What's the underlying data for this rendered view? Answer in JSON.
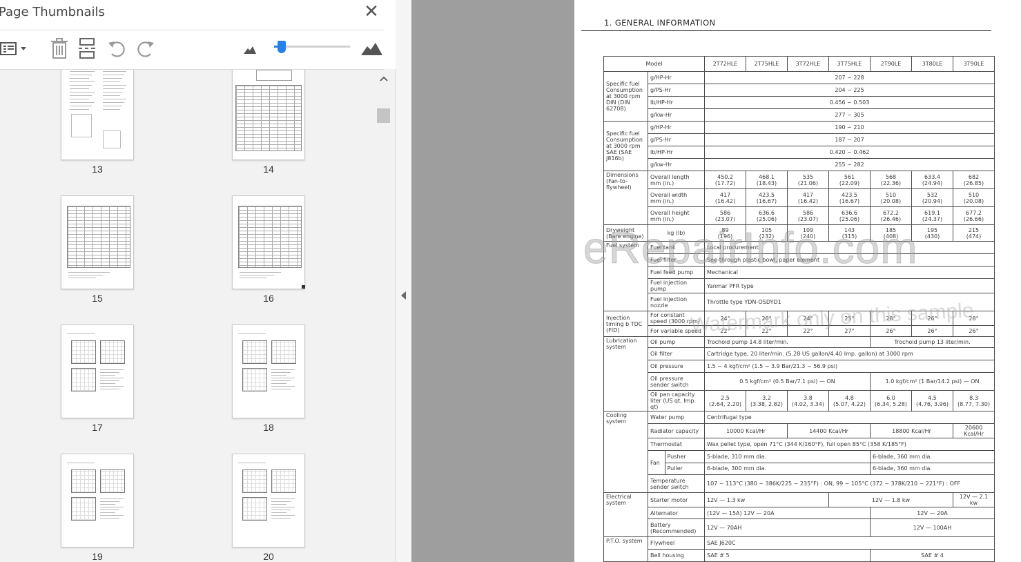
{
  "panel": {
    "title": "Page Thumbnails",
    "close_icon": "close-icon",
    "toolbar": {
      "options_icon": "thumbnail-options-icon",
      "delete_icon": "delete-pages-icon",
      "insert_icon": "insert-pages-icon",
      "rotate_left_icon": "rotate-counterclockwise-icon",
      "rotate_right_icon": "rotate-clockwise-icon",
      "zoom_out_icon": "small-thumbnail-icon",
      "zoom_in_icon": "large-thumbnail-icon",
      "thumbnail_size_fraction": 0.05
    }
  },
  "thumbnails": [
    {
      "page": "13",
      "kind": "text-figure"
    },
    {
      "page": "14",
      "kind": "table-figure"
    },
    {
      "page": "15",
      "kind": "table"
    },
    {
      "page": "16",
      "kind": "table"
    },
    {
      "page": "17",
      "kind": "curves"
    },
    {
      "page": "18",
      "kind": "curves"
    },
    {
      "page": "19",
      "kind": "curves"
    },
    {
      "page": "20",
      "kind": "curves"
    }
  ],
  "document": {
    "heading": "1. GENERAL INFORMATION",
    "watermark_main": "eRepairInfo.com",
    "watermark_sub": "Watermark only on this sample",
    "header": {
      "model_label": "Model",
      "models": [
        "2T72HLE",
        "2T75HLE",
        "3T72HLE",
        "3T75HLE",
        "2T90LE",
        "3T80LE",
        "3T90LE"
      ]
    },
    "fuel_din": {
      "group": "Specific fuel Consumption at 3000 rpm DIN (DIN 62708)",
      "rows": [
        {
          "unit": "g/HP-Hr",
          "value": "207 ~ 228"
        },
        {
          "unit": "g/PS-Hr",
          "value": "204 ~ 225"
        },
        {
          "unit": "lb/HP-Hr",
          "value": "0.456 ~ 0.503"
        },
        {
          "unit": "g/kw-Hr",
          "value": "277 ~ 305"
        }
      ]
    },
    "fuel_sae": {
      "group": "Specific fuel Consumption at 3000 rpm SAE (SAE J816b)",
      "rows": [
        {
          "unit": "g/HP-Hr",
          "value": "190 ~ 210"
        },
        {
          "unit": "g/PS-Hr",
          "value": "187 ~ 207"
        },
        {
          "unit": "lb/HP-Hr",
          "value": "0.420 ~ 0.462"
        },
        {
          "unit": "g/kw-Hr",
          "value": "255 ~ 282"
        }
      ]
    },
    "dimensions": {
      "group": "Dimensions (Fan-to-flywheel)",
      "rows": [
        {
          "label": "Overall length",
          "unit": "mm (in.)",
          "values": [
            [
              "450.2",
              "(17.72)"
            ],
            [
              "468.1",
              "(18.43)"
            ],
            [
              "535",
              "(21.06)"
            ],
            [
              "561",
              "(22.09)"
            ],
            [
              "568",
              "(22.36)"
            ],
            [
              "633.4",
              "(24.94)"
            ],
            [
              "682",
              "(26.85)"
            ]
          ]
        },
        {
          "label": "Overall width",
          "unit": "mm (in.)",
          "values": [
            [
              "417",
              "(16.42)"
            ],
            [
              "423.5",
              "(16.67)"
            ],
            [
              "417",
              "(16.42)"
            ],
            [
              "423.5",
              "(16.67)"
            ],
            [
              "510",
              "(20.08)"
            ],
            [
              "532",
              "(20.94)"
            ],
            [
              "510",
              "(20.08)"
            ]
          ]
        },
        {
          "label": "Overall height",
          "unit": "mm (in.)",
          "values": [
            [
              "586",
              "(23.07)"
            ],
            [
              "636.6",
              "(25.06)"
            ],
            [
              "586",
              "(23.07)"
            ],
            [
              "636.6",
              "(25.06)"
            ],
            [
              "672.2",
              "(26.46)"
            ],
            [
              "619.1",
              "(24.37)"
            ],
            [
              "677.2",
              "(26.66)"
            ]
          ]
        }
      ]
    },
    "dryweight": {
      "group": "Dryweight (Bare engine)",
      "unit": "kg (lb)",
      "values": [
        [
          "89",
          "(196)"
        ],
        [
          "105",
          "(232)"
        ],
        [
          "109",
          "(240)"
        ],
        [
          "143",
          "(315)"
        ],
        [
          "185",
          "(408)"
        ],
        [
          "195",
          "(430)"
        ],
        [
          "215",
          "(474)"
        ]
      ]
    },
    "fuel_system": {
      "group": "Fuel system",
      "rows": [
        {
          "label": "Fuel tank",
          "value": "Local procurement"
        },
        {
          "label": "Fuel filter",
          "value": "See-through plastic bowl, paper element"
        },
        {
          "label": "Fuel feed pump",
          "value": "Mechanical"
        },
        {
          "label": "Fuel injection pump",
          "value": "Yanmar PFR type"
        },
        {
          "label": "Fuel injection nozzle",
          "value": "Throttle type YDN-OSDYD1"
        }
      ]
    },
    "injection": {
      "group": "Injection timing b TDC (FID)",
      "rows": [
        {
          "label": "For constant speed (3000 rpm)",
          "values": [
            "24°",
            "26°",
            "24°",
            "25°",
            "28°",
            "26°",
            "28°"
          ]
        },
        {
          "label": "For variable speed",
          "values": [
            "22°",
            "22°",
            "22°",
            "27°",
            "26°",
            "26°",
            "26°"
          ]
        }
      ]
    },
    "lubrication": {
      "group": "Lubrication system",
      "oil_pump_label": "Oil pump",
      "oil_pump_a": "Trochoid pump",
      "oil_pump_a_flow": "14.8 liter/min.",
      "oil_pump_b": "Trochoid pump",
      "oil_pump_b_flow": "13 liter/min.",
      "oil_filter_label": "Oil filter",
      "oil_filter": "Cartridge type, 20 liter/min. (5.28 US gallon/4.40 Imp. gallon) at 3000 rpm",
      "oil_pressure_label": "Oil pressure",
      "oil_pressure": "1.5 ~ 4 kgf/cm²  (1.5 ~ 3.9 Bar/21.3 ~ 56.9 psi)",
      "sender_label": "Oil pressure sender switch",
      "sender_a": "0.5 kgf/cm² (0.5 Bar/7.1 psi) — ON",
      "sender_b": "1.0 kgf/cm² (1 Bar/14.2 psi) — ON",
      "pan_label": "Oil pan capacity liter (US qt, Imp. qt)",
      "pan_values": [
        [
          "2.5",
          "(2.64, 2.20)"
        ],
        [
          "3.2",
          "(3.38, 2.82)"
        ],
        [
          "3.8",
          "(4.02, 3.34)"
        ],
        [
          "4.8",
          "(5.07, 4.22)"
        ],
        [
          "6.0",
          "(6.34, 5.28)"
        ],
        [
          "4.5",
          "(4.76, 3.96)"
        ],
        [
          "8.3",
          "(8.77, 7.30)"
        ]
      ]
    },
    "cooling": {
      "group": "Cooling system",
      "water_pump_label": "Water pump",
      "water_pump": "Centrifugal type",
      "radiator_label": "Radiator capacity",
      "radiator": [
        "10000 Kcal/Hr",
        "14400 Kcal/Hr",
        "18800 Kcal/Hr",
        "20600 Kcal/Hr"
      ],
      "thermostat_label": "Thermostat",
      "thermostat": "Wax pellet type, open 71°C (344 K/160°F), full open 85°C (358 K/185°F)",
      "fan_label": "Fan",
      "pusher_label": "Pusher",
      "pusher_a": "5-blade, 310 mm dia.",
      "pusher_b": "6-blade, 360 mm dia.",
      "puller_label": "Puller",
      "puller_a": "6-blade, 300 mm dia.",
      "puller_b": "6-blade, 360 mm dia.",
      "temp_label": "Temperature sender switch",
      "temp_on": "107 ~ 113°C (380 ~ 386K/225 ~ 235°F) :  ON,",
      "temp_off": "99 ~ 105°C (372 ~ 378K/210 ~ 221°F) :  OFF"
    },
    "electrical": {
      "group": "Electrical system",
      "starter_label": "Starter motor",
      "starter": [
        "12V — 1.3 kw",
        "12V — 1.8 kw",
        "12V — 2.1 kw"
      ],
      "alternator_label": "Alternator",
      "alternator": [
        "(12V — 15A)   12V — 20A",
        "12V — 20A"
      ],
      "battery_label": "Battery (Recommended)",
      "battery": [
        "12V — 70AH",
        "12V — 100AH"
      ]
    },
    "pto": {
      "group": "P.T.O. system",
      "flywheel_label": "Flywheel",
      "flywheel": "SAE  J620C",
      "bell_label": "Bell housing",
      "bell_a": "SAE  # 5",
      "bell_b": "SAE  # 4"
    }
  }
}
